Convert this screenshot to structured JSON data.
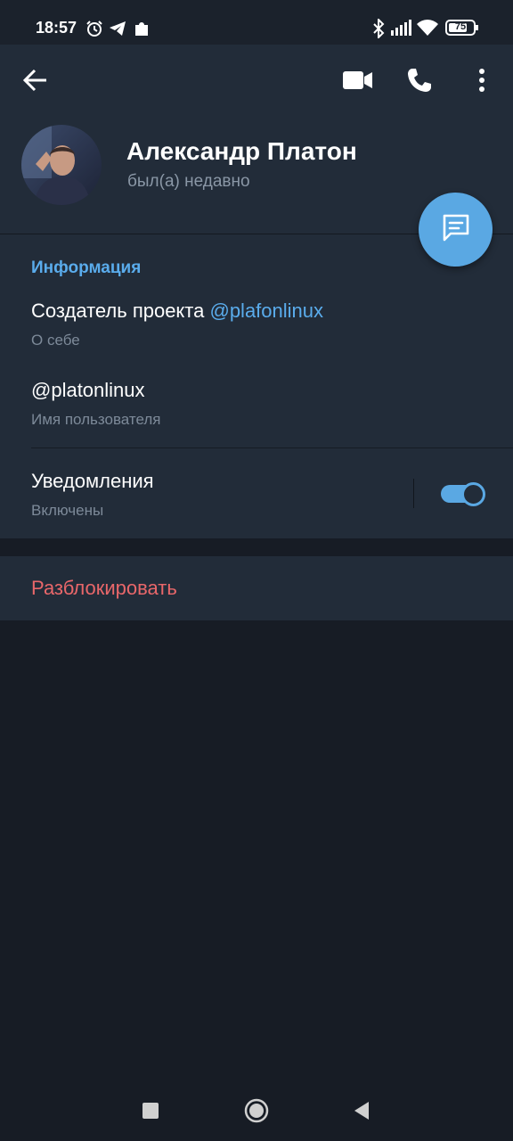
{
  "status_bar": {
    "time": "18:57",
    "battery": "75",
    "icons": [
      "alarm-icon",
      "telegram-icon",
      "puzzle-icon",
      "bluetooth-icon",
      "signal-icon",
      "wifi-icon",
      "battery-icon"
    ]
  },
  "header": {
    "back_icon": "arrow-left-icon",
    "actions": [
      "video-call-icon",
      "phone-icon",
      "more-vert-icon"
    ],
    "name": "Александр Платон",
    "status": "был(а) недавно"
  },
  "info": {
    "section_title": "Информация",
    "bio_prefix": "Создатель проекта ",
    "bio_link": "@plafonlinux",
    "bio_caption": "О себе",
    "username": "@platonlinux",
    "username_caption": "Имя пользователя",
    "notifications_label": "Уведомления",
    "notifications_state": "Включены",
    "notifications_on": true
  },
  "actions": {
    "unblock": "Разблокировать"
  },
  "colors": {
    "background": "#171c25",
    "panel": "#222c39",
    "accent": "#5aa8e3",
    "danger": "#e9676a"
  }
}
